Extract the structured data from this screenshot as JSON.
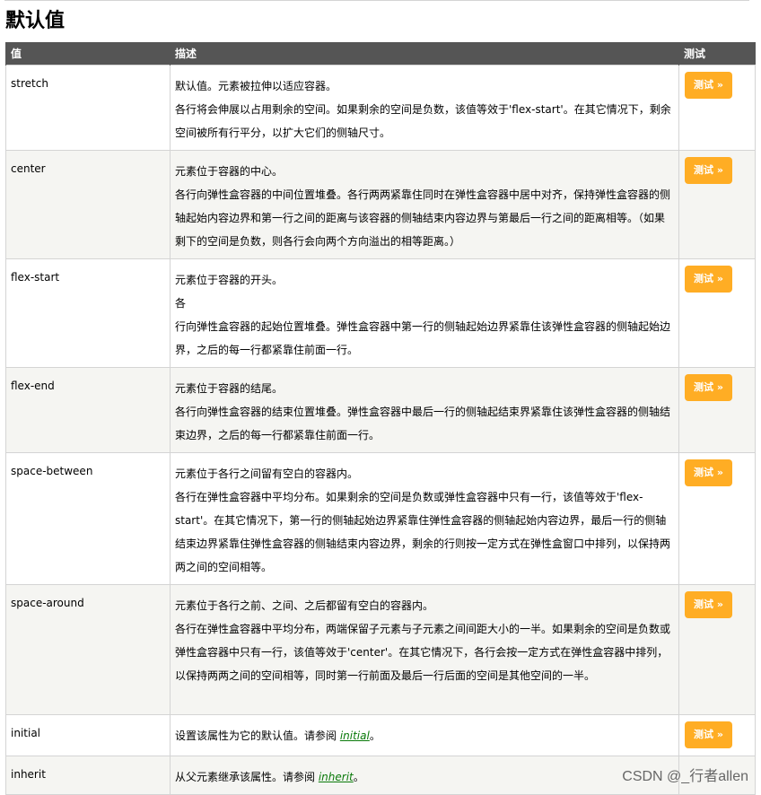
{
  "section_title": "默认值",
  "table": {
    "headers": {
      "value": "值",
      "description": "描述",
      "test": "测试"
    },
    "rows": [
      {
        "value": "stretch",
        "lines": [
          "默认值。元素被拉伸以适应容器。",
          "各行将会伸展以占用剩余的空间。如果剩余的空间是负数，该值等效于'flex-start'。在其它情况下，剩余空间被所有行平分，以扩大它们的侧轴尺寸。"
        ],
        "button": "测试 »"
      },
      {
        "value": "center",
        "lines": [
          "元素位于容器的中心。",
          "各行向弹性盒容器的中间位置堆叠。各行两两紧靠住同时在弹性盒容器中居中对齐，保持弹性盒容器的侧轴起始内容边界和第一行之间的距离与该容器的侧轴结束内容边界与第最后一行之间的距离相等。（如果剩下的空间是负数，则各行会向两个方向溢出的相等距离。）"
        ],
        "button": "测试 »"
      },
      {
        "value": "flex-start",
        "lines": [
          "元素位于容器的开头。",
          "各",
          "行向弹性盒容器的起始位置堆叠。弹性盒容器中第一行的侧轴起始边界紧靠住该弹性盒容器的侧轴起始边界，之后的每一行都紧靠住前面一行。"
        ],
        "button": "测试 »"
      },
      {
        "value": "flex-end",
        "lines": [
          "元素位于容器的结尾。",
          "各行向弹性盒容器的结束位置堆叠。弹性盒容器中最后一行的侧轴起结束界紧靠住该弹性盒容器的侧轴结束边界，之后的每一行都紧靠住前面一行。"
        ],
        "button": "测试 »"
      },
      {
        "value": "space-between",
        "lines": [
          "元素位于各行之间留有空白的容器内。",
          "各行在弹性盒容器中平均分布。如果剩余的空间是负数或弹性盒容器中只有一行，该值等效于'flex-start'。在其它情况下，第一行的侧轴起始边界紧靠住弹性盒容器的侧轴起始内容边界，最后一行的侧轴结束边界紧靠住弹性盒容器的侧轴结束内容边界，剩余的行则按一定方式在弹性盒窗口中排列，以保持两两之间的空间相等。"
        ],
        "button": "测试 »"
      },
      {
        "value": "space-around",
        "lines": [
          "元素位于各行之前、之间、之后都留有空白的容器内。",
          "各行在弹性盒容器中平均分布，两端保留子元素与子元素之间间距大小的一半。如果剩余的空间是负数或弹性盒容器中只有一行，该值等效于'center'。在其它情况下，各行会按一定方式在弹性盒容器中排列，以保持两两之间的空间相等，同时第一行前面及最后一行后面的空间是其他空间的一半。"
        ],
        "button": "测试 »"
      },
      {
        "value": "initial",
        "lines": [],
        "text_before_link": "设置该属性为它的默认值。请参阅 ",
        "link_text": "initial",
        "text_after_link": "。",
        "button": "测试 »"
      },
      {
        "value": "inherit",
        "lines": [],
        "text_before_link": "从父元素继承该属性。请参阅 ",
        "link_text": "inherit",
        "text_after_link": "。",
        "button": ""
      }
    ]
  },
  "watermark": "CSDN @_行者allen",
  "colors": {
    "header_bg": "#555555",
    "button_bg": "#ffad24",
    "alt_row_bg": "#f5f5f2",
    "link": "#0a7a0a"
  }
}
